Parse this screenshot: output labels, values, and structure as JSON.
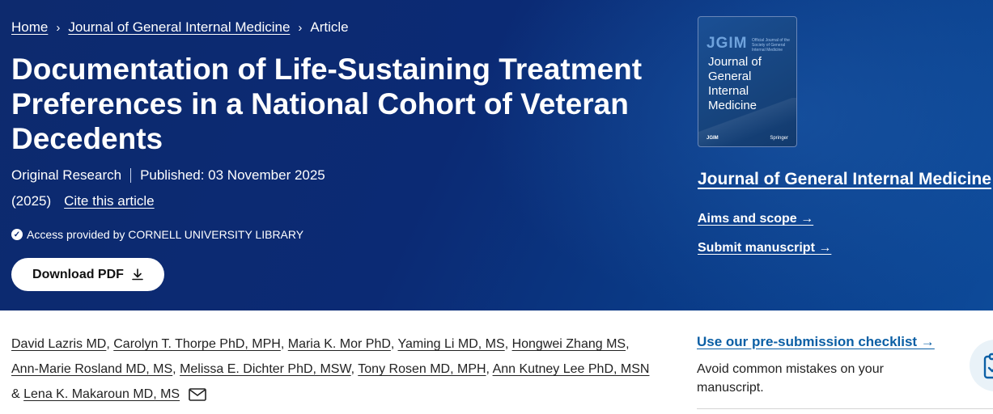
{
  "breadcrumb": {
    "home": "Home",
    "separator": "›",
    "journal": "Journal of General Internal Medicine",
    "current": "Article"
  },
  "article": {
    "title": "Documentation of Life-Sustaining Treatment Preferences in a National Cohort of Veteran Decedents",
    "type": "Original Research",
    "published": "Published: 03 November 2025",
    "year": "(2025)",
    "cite": "Cite this article",
    "access": "Access provided by CORNELL UNIVERSITY LIBRARY",
    "download_label": "Download PDF",
    "download_icon": "download-icon"
  },
  "journal_cover": {
    "abbr": "JGIM",
    "subtitle": "Official Journal of the Society of General Internal Medicine",
    "name": "Journal of General Internal Medicine",
    "publisher_left": "JGIM",
    "publisher_right": "Springer"
  },
  "journal_panel": {
    "name": "Journal of General Internal Medicine",
    "links": [
      "Aims and scope →",
      "Submit manuscript →"
    ]
  },
  "authors": {
    "list": [
      "David Lazris MD",
      "Carolyn T. Thorpe PhD, MPH",
      "Maria K. Mor PhD",
      "Yaming Li MD, MS",
      "Hongwei Zhang MS",
      "Ann-Marie Rosland MD, MS",
      "Melissa E. Dichter PhD, MSW",
      "Tony Rosen MD, MPH",
      "Ann Kutney Lee PhD, MSN",
      "Lena K. Makaroun MD, MS"
    ],
    "comma": ", ",
    "ampersand": " & ",
    "mail_icon": "mail-icon"
  },
  "sidebar": {
    "checklist_link": "Use our pre-submission checklist →",
    "checklist_text": "Avoid common mistakes on your manuscript.",
    "bubble_icon": "clipboard-check-icon"
  },
  "colors": {
    "hero_bg": "#0b2a74",
    "link_blue": "#0b5fa5",
    "text": "#222222"
  }
}
